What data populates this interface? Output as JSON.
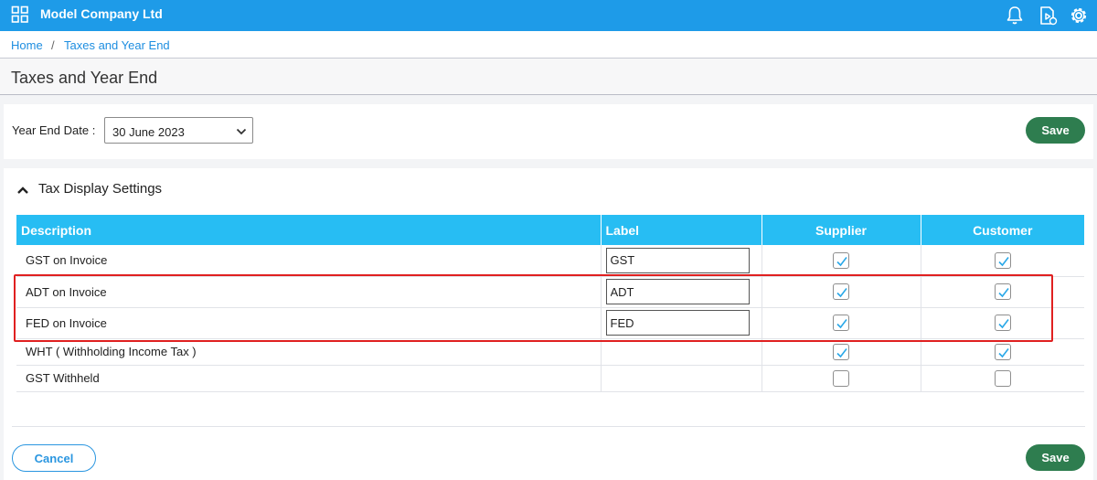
{
  "header": {
    "company": "Model Company Ltd",
    "icons": [
      "apps-grid-icon",
      "bell-icon",
      "video-help-icon",
      "gear-icon"
    ]
  },
  "breadcrumb": {
    "home": "Home",
    "separator": "/",
    "current": "Taxes and Year End"
  },
  "page": {
    "title": "Taxes and Year End"
  },
  "year_end": {
    "label": "Year End Date :",
    "selected": "30 June 2023",
    "save_label": "Save"
  },
  "tax_settings": {
    "title": "Tax Display Settings",
    "columns": [
      "Description",
      "Label",
      "Supplier",
      "Customer"
    ],
    "rows": [
      {
        "description": "GST on Invoice",
        "label": "GST",
        "supplier": true,
        "customer": true
      },
      {
        "description": "ADT on Invoice",
        "label": "ADT",
        "supplier": true,
        "customer": true
      },
      {
        "description": "FED on Invoice",
        "label": "FED",
        "supplier": true,
        "customer": true
      },
      {
        "description": "WHT ( Withholding Income Tax )",
        "label": null,
        "supplier": true,
        "customer": true
      },
      {
        "description": "GST Withheld",
        "label": null,
        "supplier": false,
        "customer": false
      }
    ]
  },
  "footer": {
    "cancel_label": "Cancel",
    "save_label": "Save"
  },
  "colors": {
    "topbar": "#1e9be8",
    "table_header": "#27bdf3",
    "save_button": "#2e7d4f",
    "highlight": "#e02020",
    "link": "#1e8ee0"
  }
}
